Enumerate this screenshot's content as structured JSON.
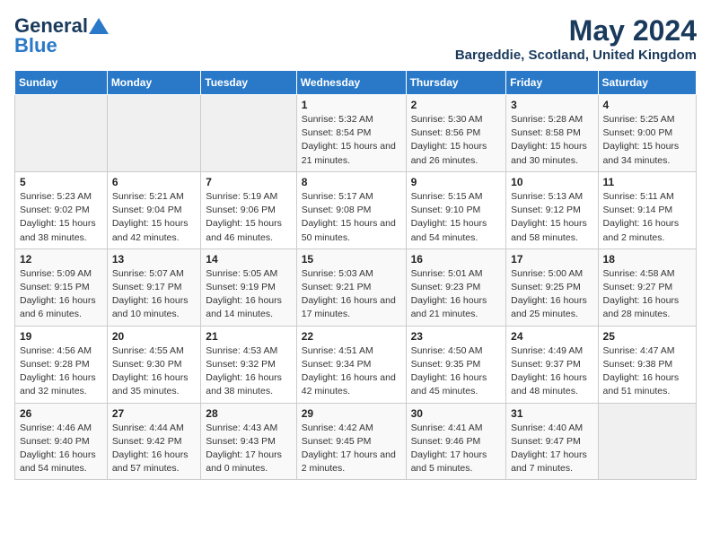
{
  "logo": {
    "general": "General",
    "blue": "Blue"
  },
  "header": {
    "title": "May 2024",
    "subtitle": "Bargeddie, Scotland, United Kingdom"
  },
  "days_of_week": [
    "Sunday",
    "Monday",
    "Tuesday",
    "Wednesday",
    "Thursday",
    "Friday",
    "Saturday"
  ],
  "weeks": [
    [
      {
        "num": "",
        "detail": ""
      },
      {
        "num": "",
        "detail": ""
      },
      {
        "num": "",
        "detail": ""
      },
      {
        "num": "1",
        "detail": "Sunrise: 5:32 AM\nSunset: 8:54 PM\nDaylight: 15 hours\nand 21 minutes."
      },
      {
        "num": "2",
        "detail": "Sunrise: 5:30 AM\nSunset: 8:56 PM\nDaylight: 15 hours\nand 26 minutes."
      },
      {
        "num": "3",
        "detail": "Sunrise: 5:28 AM\nSunset: 8:58 PM\nDaylight: 15 hours\nand 30 minutes."
      },
      {
        "num": "4",
        "detail": "Sunrise: 5:25 AM\nSunset: 9:00 PM\nDaylight: 15 hours\nand 34 minutes."
      }
    ],
    [
      {
        "num": "5",
        "detail": "Sunrise: 5:23 AM\nSunset: 9:02 PM\nDaylight: 15 hours\nand 38 minutes."
      },
      {
        "num": "6",
        "detail": "Sunrise: 5:21 AM\nSunset: 9:04 PM\nDaylight: 15 hours\nand 42 minutes."
      },
      {
        "num": "7",
        "detail": "Sunrise: 5:19 AM\nSunset: 9:06 PM\nDaylight: 15 hours\nand 46 minutes."
      },
      {
        "num": "8",
        "detail": "Sunrise: 5:17 AM\nSunset: 9:08 PM\nDaylight: 15 hours\nand 50 minutes."
      },
      {
        "num": "9",
        "detail": "Sunrise: 5:15 AM\nSunset: 9:10 PM\nDaylight: 15 hours\nand 54 minutes."
      },
      {
        "num": "10",
        "detail": "Sunrise: 5:13 AM\nSunset: 9:12 PM\nDaylight: 15 hours\nand 58 minutes."
      },
      {
        "num": "11",
        "detail": "Sunrise: 5:11 AM\nSunset: 9:14 PM\nDaylight: 16 hours\nand 2 minutes."
      }
    ],
    [
      {
        "num": "12",
        "detail": "Sunrise: 5:09 AM\nSunset: 9:15 PM\nDaylight: 16 hours\nand 6 minutes."
      },
      {
        "num": "13",
        "detail": "Sunrise: 5:07 AM\nSunset: 9:17 PM\nDaylight: 16 hours\nand 10 minutes."
      },
      {
        "num": "14",
        "detail": "Sunrise: 5:05 AM\nSunset: 9:19 PM\nDaylight: 16 hours\nand 14 minutes."
      },
      {
        "num": "15",
        "detail": "Sunrise: 5:03 AM\nSunset: 9:21 PM\nDaylight: 16 hours\nand 17 minutes."
      },
      {
        "num": "16",
        "detail": "Sunrise: 5:01 AM\nSunset: 9:23 PM\nDaylight: 16 hours\nand 21 minutes."
      },
      {
        "num": "17",
        "detail": "Sunrise: 5:00 AM\nSunset: 9:25 PM\nDaylight: 16 hours\nand 25 minutes."
      },
      {
        "num": "18",
        "detail": "Sunrise: 4:58 AM\nSunset: 9:27 PM\nDaylight: 16 hours\nand 28 minutes."
      }
    ],
    [
      {
        "num": "19",
        "detail": "Sunrise: 4:56 AM\nSunset: 9:28 PM\nDaylight: 16 hours\nand 32 minutes."
      },
      {
        "num": "20",
        "detail": "Sunrise: 4:55 AM\nSunset: 9:30 PM\nDaylight: 16 hours\nand 35 minutes."
      },
      {
        "num": "21",
        "detail": "Sunrise: 4:53 AM\nSunset: 9:32 PM\nDaylight: 16 hours\nand 38 minutes."
      },
      {
        "num": "22",
        "detail": "Sunrise: 4:51 AM\nSunset: 9:34 PM\nDaylight: 16 hours\nand 42 minutes."
      },
      {
        "num": "23",
        "detail": "Sunrise: 4:50 AM\nSunset: 9:35 PM\nDaylight: 16 hours\nand 45 minutes."
      },
      {
        "num": "24",
        "detail": "Sunrise: 4:49 AM\nSunset: 9:37 PM\nDaylight: 16 hours\nand 48 minutes."
      },
      {
        "num": "25",
        "detail": "Sunrise: 4:47 AM\nSunset: 9:38 PM\nDaylight: 16 hours\nand 51 minutes."
      }
    ],
    [
      {
        "num": "26",
        "detail": "Sunrise: 4:46 AM\nSunset: 9:40 PM\nDaylight: 16 hours\nand 54 minutes."
      },
      {
        "num": "27",
        "detail": "Sunrise: 4:44 AM\nSunset: 9:42 PM\nDaylight: 16 hours\nand 57 minutes."
      },
      {
        "num": "28",
        "detail": "Sunrise: 4:43 AM\nSunset: 9:43 PM\nDaylight: 17 hours\nand 0 minutes."
      },
      {
        "num": "29",
        "detail": "Sunrise: 4:42 AM\nSunset: 9:45 PM\nDaylight: 17 hours\nand 2 minutes."
      },
      {
        "num": "30",
        "detail": "Sunrise: 4:41 AM\nSunset: 9:46 PM\nDaylight: 17 hours\nand 5 minutes."
      },
      {
        "num": "31",
        "detail": "Sunrise: 4:40 AM\nSunset: 9:47 PM\nDaylight: 17 hours\nand 7 minutes."
      },
      {
        "num": "",
        "detail": ""
      }
    ]
  ]
}
